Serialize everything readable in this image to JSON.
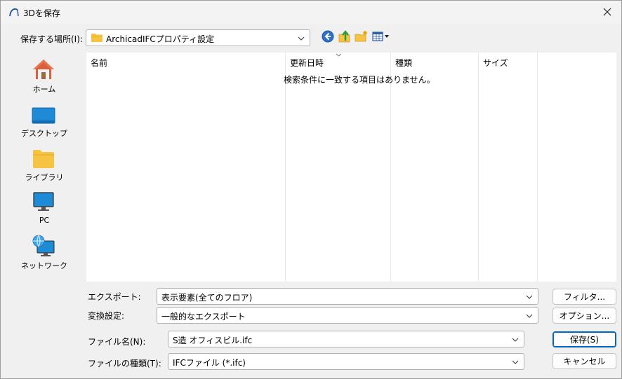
{
  "window": {
    "title": "3Dを保存"
  },
  "location": {
    "label": "保存する場所(I):",
    "value": "ArchicadIFCプロパティ設定"
  },
  "toolbar": {
    "icons": [
      "back-icon",
      "up-folder-icon",
      "new-folder-icon",
      "view-menu-icon"
    ]
  },
  "places": [
    {
      "label": "ホーム",
      "icon": "home-icon"
    },
    {
      "label": "デスクトップ",
      "icon": "desktop-icon"
    },
    {
      "label": "ライブラリ",
      "icon": "library-folder-icon"
    },
    {
      "label": "PC",
      "icon": "pc-monitor-icon"
    },
    {
      "label": "ネットワーク",
      "icon": "network-icon"
    }
  ],
  "filelist": {
    "columns": [
      "名前",
      "更新日時",
      "種類",
      "サイズ"
    ],
    "empty_message": "検索条件に一致する項目はありません。"
  },
  "export": {
    "label": "エクスポート:",
    "value": "表示要素(全てのフロア)"
  },
  "conversion": {
    "label": "変換設定:",
    "value": "一般的なエクスポート"
  },
  "filename": {
    "label": "ファイル名(N):",
    "value": "S造 オフィスビル.ifc"
  },
  "filetype": {
    "label": "ファイルの種類(T):",
    "value": "IFCファイル (*.ifc)"
  },
  "buttons": {
    "filter": "フィルタ...",
    "options": "オプション...",
    "save": "保存(S)",
    "cancel": "キャンセル"
  },
  "colors": {
    "accent": "#0067c0",
    "folder": "#f6c343"
  }
}
